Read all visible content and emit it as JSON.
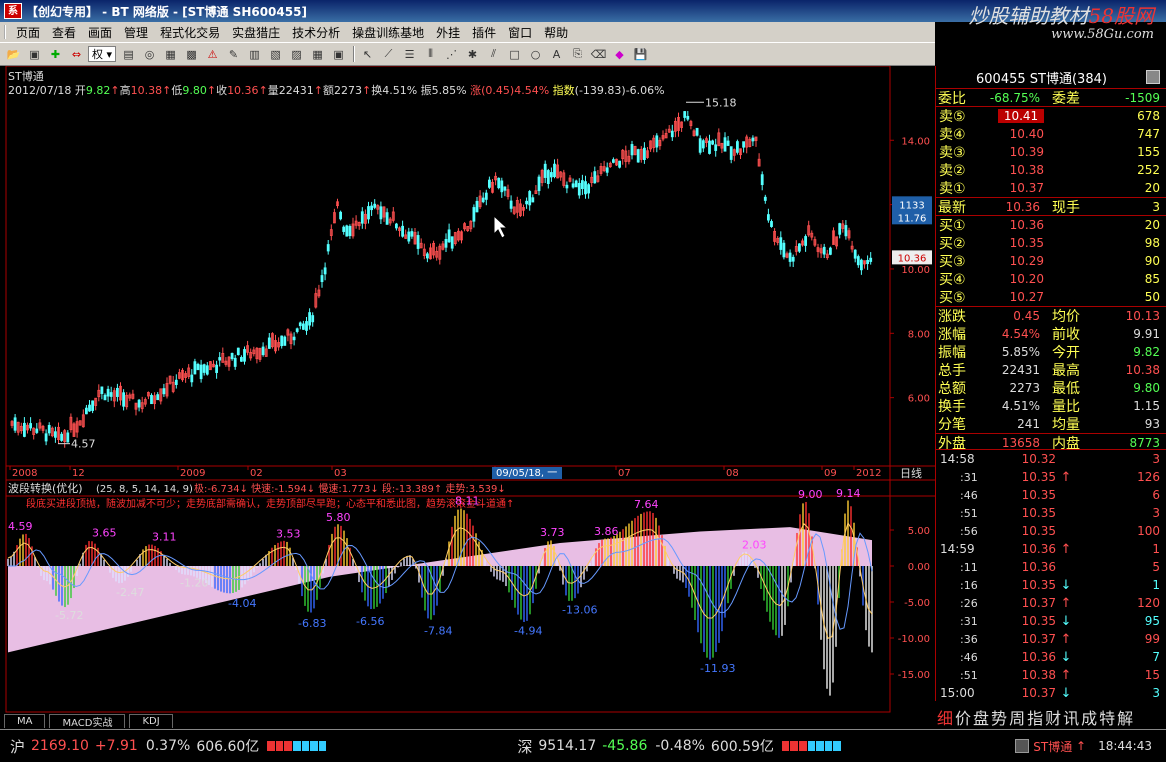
{
  "window": {
    "title": "【创幻专用】 - BT 网络版 - [ST博通 SH600455]",
    "icon_text": "系",
    "watermark_title_a": "炒股辅助教材",
    "watermark_title_b": "58股网",
    "watermark_url": "www.58Gu.com"
  },
  "menu": [
    "页面",
    "查看",
    "画面",
    "管理",
    "程式化交易",
    "实盘猎庄",
    "技术分析",
    "操盘训练基地",
    "外挂",
    "插件",
    "窗口",
    "帮助"
  ],
  "toolbar": {
    "combo_label": "权"
  },
  "chart": {
    "stock_name": "ST博通",
    "date": "2012/07/18",
    "open_label": "开",
    "open": "9.82",
    "high_label": "高",
    "high": "10.38",
    "low_label": "低",
    "low": "9.80",
    "close_label": "收",
    "close": "10.36",
    "vol_label": "量",
    "vol": "22431",
    "amount_label": "额",
    "amount": "2273",
    "turnover_label": "换",
    "turnover": "4.51%",
    "amplitude_label": "振",
    "amplitude": "5.85%",
    "change_label": "涨",
    "change": "(0.45)",
    "change_pct": "4.54%",
    "index_label": "指数",
    "index": "(-139.83)-6.06%",
    "cursor_price_top": "1133",
    "cursor_price": "11.76",
    "last_price": "10.36",
    "price_ticks": [
      "14.00",
      "12.00",
      "10.00",
      "8.00",
      "6.00"
    ],
    "high_mark": "15.18",
    "low_mark": "4.57",
    "date_ticks": [
      "2008",
      "12",
      "2009",
      "02",
      "03",
      "05",
      "07",
      "08",
      "09",
      "2012"
    ],
    "date_cursor": "09/05/18, 一",
    "period_label": "日线",
    "indicator_title": "波段转换(优化)",
    "indicator_params": "(25, 8, 5, 14, 14, 9)",
    "indicator_values": "极:-6.734↓ 快速:-1.594↓ 慢速:1.773↓ 段:-13.389↑ 走势:3.539↓",
    "indicator_hint": "段底买进段顶抛，随波加减不可少；走势底部需确认，走势顶部尽早跑；心态平和悉此图，趋势滚滚金斗道通↑",
    "ind_ticks": [
      "5.00",
      "0.00",
      "-5.00",
      "-10.00",
      "-15.00"
    ],
    "ind_peaks": [
      "4.59",
      "3.65",
      "3.11",
      "3.53",
      "5.80",
      "8.11",
      "3.73",
      "3.86",
      "7.64",
      "2.03",
      "9.00",
      "9.14"
    ],
    "ind_troughs": [
      "-5.72",
      "-2.47",
      "-1.20",
      "-4.04",
      "-6.83",
      "-6.56",
      "-7.84",
      "-4.94",
      "-13.06",
      "-11.93"
    ]
  },
  "chart_data": {
    "type": "candlestick",
    "series": [
      {
        "name": "ST博通",
        "x_ticks": [
          "2008",
          "12",
          "2009",
          "02",
          "03",
          "05",
          "07",
          "08",
          "09",
          "2012"
        ]
      }
    ],
    "ylim": [
      4.0,
      15.5
    ],
    "high": 15.18,
    "low": 4.57
  },
  "quote": {
    "code": "600455",
    "name": "ST博通",
    "count": "(384)",
    "weibi_label": "委比",
    "weibi": "-68.75%",
    "weicha_label": "委差",
    "weicha": "-1509",
    "sells": [
      {
        "label": "卖⑤",
        "price": "10.41",
        "vol": "678"
      },
      {
        "label": "卖④",
        "price": "10.40",
        "vol": "747"
      },
      {
        "label": "卖③",
        "price": "10.39",
        "vol": "155"
      },
      {
        "label": "卖②",
        "price": "10.38",
        "vol": "252"
      },
      {
        "label": "卖①",
        "price": "10.37",
        "vol": "20"
      }
    ],
    "latest_label": "最新",
    "latest": "10.36",
    "now_hand_label": "现手",
    "now_hand": "3",
    "buys": [
      {
        "label": "买①",
        "price": "10.36",
        "vol": "20"
      },
      {
        "label": "买②",
        "price": "10.35",
        "vol": "98"
      },
      {
        "label": "买③",
        "price": "10.29",
        "vol": "90"
      },
      {
        "label": "买④",
        "price": "10.20",
        "vol": "85"
      },
      {
        "label": "买⑤",
        "price": "10.27",
        "vol": "50"
      }
    ],
    "stats": [
      {
        "l1": "涨跌",
        "v1": "0.45",
        "c1": "red",
        "l2": "均价",
        "v2": "10.13",
        "c2": "red"
      },
      {
        "l1": "涨幅",
        "v1": "4.54%",
        "c1": "red",
        "l2": "前收",
        "v2": "9.91",
        "c2": "white"
      },
      {
        "l1": "振幅",
        "v1": "5.85%",
        "c1": "white",
        "l2": "今开",
        "v2": "9.82",
        "c2": "green"
      },
      {
        "l1": "总手",
        "v1": "22431",
        "c1": "white",
        "l2": "最高",
        "v2": "10.38",
        "c2": "red"
      },
      {
        "l1": "总额",
        "v1": "2273",
        "c1": "white",
        "l2": "最低",
        "v2": "9.80",
        "c2": "green"
      },
      {
        "l1": "换手",
        "v1": "4.51%",
        "c1": "white",
        "l2": "量比",
        "v2": "1.15",
        "c2": "white"
      },
      {
        "l1": "分笔",
        "v1": "241",
        "c1": "white",
        "l2": "均量",
        "v2": "93",
        "c2": "white"
      }
    ],
    "outer_label": "外盘",
    "outer": "13658",
    "inner_label": "内盘",
    "inner": "8773"
  },
  "ticks": [
    {
      "t": "14:58",
      "p": "10.32",
      "a": "",
      "v": "3",
      "small": false
    },
    {
      "t": ":31",
      "p": "10.35",
      "a": "↑",
      "v": "126",
      "small": true
    },
    {
      "t": ":46",
      "p": "10.35",
      "a": "",
      "v": "6",
      "small": true
    },
    {
      "t": ":51",
      "p": "10.35",
      "a": "",
      "v": "3",
      "small": true
    },
    {
      "t": ":56",
      "p": "10.35",
      "a": "",
      "v": "100",
      "small": true
    },
    {
      "t": "14:59",
      "p": "10.36",
      "a": "↑",
      "v": "1",
      "small": false
    },
    {
      "t": ":11",
      "p": "10.36",
      "a": "",
      "v": "5",
      "small": true
    },
    {
      "t": ":16",
      "p": "10.35",
      "a": "↓",
      "v": "1",
      "small": true
    },
    {
      "t": ":26",
      "p": "10.37",
      "a": "↑",
      "v": "120",
      "small": true
    },
    {
      "t": ":31",
      "p": "10.35",
      "a": "↓",
      "v": "95",
      "small": true
    },
    {
      "t": ":36",
      "p": "10.37",
      "a": "↑",
      "v": "99",
      "small": true
    },
    {
      "t": ":46",
      "p": "10.36",
      "a": "↓",
      "v": "7",
      "small": true
    },
    {
      "t": ":51",
      "p": "10.38",
      "a": "↑",
      "v": "15",
      "small": true
    },
    {
      "t": "15:00",
      "p": "10.37",
      "a": "↓",
      "v": "3",
      "small": false
    }
  ],
  "info_strip": [
    "细",
    "价",
    "盘",
    "势",
    "周",
    "指",
    "财",
    "讯",
    "成",
    "特",
    "解"
  ],
  "tabs": [
    "MA",
    "MACD实战",
    "KDJ"
  ],
  "status": {
    "sh_label": "沪",
    "sh_index": "2169.10",
    "sh_change": "+7.91",
    "sh_pct": "0.37%",
    "sh_amount": "606.60亿",
    "sz_label": "深",
    "sz_index": "9514.17",
    "sz_change": "-45.86",
    "sz_pct": "-0.48%",
    "sz_amount": "600.59亿",
    "stock_tag": "ST博通",
    "clock": "18:44:43"
  },
  "colors": {
    "up": "#ff5050",
    "down": "#54ffff",
    "grid": "#a00000",
    "label": "#ffff54"
  }
}
